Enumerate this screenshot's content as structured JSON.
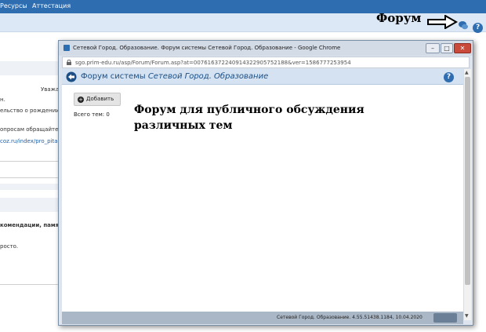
{
  "background": {
    "nav": {
      "resources": "Ресурсы",
      "certification": "Аттестация"
    },
    "fragments": [
      "Уважаемые ро",
      "н.",
      "ельство о рождении",
      "опросам обращайте",
      "cоz.ru/index/pro_pita",
      "комендации, памятки, к",
      "росто."
    ]
  },
  "annotations": {
    "forum_label": "Форум",
    "description": "Форум для публичного обсуждения различных тем"
  },
  "window": {
    "title": "Сетевой Город. Образование. Форум системы Сетевой Город. Образование - Google Chrome",
    "controls": {
      "minimize": "–",
      "maximize": "□",
      "close": "✕"
    },
    "url": "sgo.prim-edu.ru/asp/Forum/Forum.asp?at=007616372240914322905752188&ver=1586777253954"
  },
  "page": {
    "title_prefix": "Форум системы",
    "title_brand": "Сетевой Город. Образование",
    "help_label": "?",
    "add_button": "Добавить",
    "topic_count": "Всего тем: 0",
    "footer": "Сетевой Город. Образование. 4.55.51438.1184, 10.04.2020"
  },
  "colors": {
    "nav_blue": "#2d6db0",
    "header_bg": "#d4e2f1",
    "title_text": "#1b4f86"
  },
  "icons": [
    "back-arrow-icon",
    "help-icon",
    "plus-circle-icon",
    "lock-icon",
    "chat-icon",
    "arrow-pointer-icon"
  ]
}
